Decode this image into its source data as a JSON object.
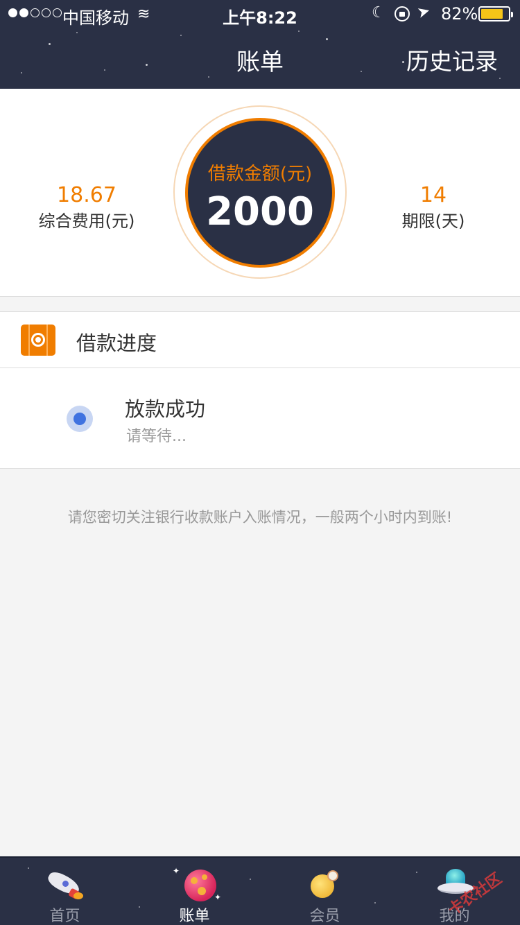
{
  "status_bar": {
    "carrier": "中国移动",
    "time": "上午8:22",
    "battery_percent": "82%",
    "signal_strength": 2,
    "signal_total": 5,
    "battery_level": 0.82,
    "icons": [
      "wifi-icon",
      "moon-icon",
      "orientation-lock-icon",
      "location-icon",
      "battery-icon"
    ]
  },
  "nav": {
    "title": "账单",
    "history_label": "历史记录"
  },
  "summary": {
    "fee_value": "18.67",
    "fee_label": "综合费用(元)",
    "amount_label": "借款金额(元)",
    "amount_value": "2000",
    "term_value": "14",
    "term_label": "期限(天)"
  },
  "progress": {
    "title": "借款进度",
    "items": [
      {
        "title": "放款成功",
        "subtitle": "请等待..."
      }
    ]
  },
  "notice": "请您密切关注银行收款账户入账情况，一般两个小时内到账!",
  "tabs": [
    {
      "label": "首页",
      "icon": "rocket-icon",
      "active": false
    },
    {
      "label": "账单",
      "icon": "planet-icon",
      "active": true
    },
    {
      "label": "会员",
      "icon": "moon-planet-icon",
      "active": false
    },
    {
      "label": "我的",
      "icon": "ufo-icon",
      "active": false
    }
  ],
  "colors": {
    "header_bg": "#2a3045",
    "accent_orange": "#f07d00",
    "status_blue": "#3f72e0",
    "page_bg": "#f4f4f4"
  },
  "watermark": "卡农社区"
}
